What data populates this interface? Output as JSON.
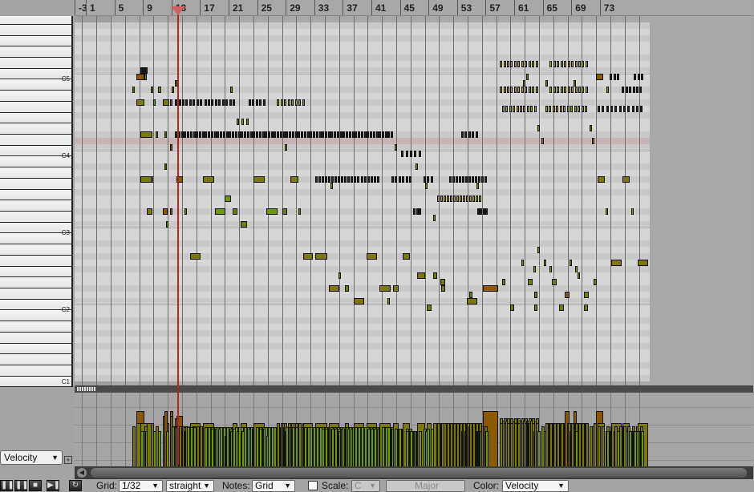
{
  "ruler": {
    "labels": [
      "-3",
      "1",
      "5",
      "9",
      "13",
      "17",
      "21",
      "25",
      "29",
      "33",
      "37",
      "41",
      "45",
      "49",
      "53",
      "57",
      "61",
      "65",
      "69",
      "73"
    ]
  },
  "keyboard": {
    "octave_labels": [
      {
        "label": "C5",
        "pitch": 72
      },
      {
        "label": "C4",
        "pitch": 60
      },
      {
        "label": "C3",
        "pitch": 48
      },
      {
        "label": "C2",
        "pitch": 36
      },
      {
        "label": "C1",
        "pitch": 24
      }
    ]
  },
  "highlight_pitch": 62,
  "playhead_bar": 10.4,
  "colors": {
    "vel_high": "#8a5a00",
    "vel_mid": "#7a7a00",
    "vel_low": "#6e9a00",
    "playhead": "#c02020",
    "highlight_row": "#c8b4b4"
  },
  "notes": [
    [
      72,
      4.6,
      1.1,
      110
    ],
    [
      72,
      5.7,
      0.3,
      80
    ],
    [
      72,
      59.2,
      0.15,
      90
    ],
    [
      72,
      69.0,
      1.0,
      110
    ],
    [
      71,
      10.0,
      0.2,
      95
    ],
    [
      71,
      58.8,
      0.15,
      90
    ],
    [
      71,
      61.9,
      0.15,
      80
    ],
    [
      71,
      65.8,
      0.15,
      110
    ],
    [
      70,
      4.0,
      0.2,
      80
    ],
    [
      70,
      6.6,
      0.2,
      80
    ],
    [
      70,
      7.6,
      0.5,
      70
    ],
    [
      70,
      9.5,
      0.2,
      80
    ],
    [
      70,
      17.7,
      0.15,
      70
    ],
    [
      70,
      70.4,
      0.15,
      70
    ],
    [
      68,
      4.6,
      1.1,
      85
    ],
    [
      68,
      7.0,
      0.2,
      70
    ],
    [
      68,
      8.3,
      0.9,
      85
    ],
    [
      68,
      9.3,
      0.3,
      110
    ],
    [
      65,
      18.6,
      0.15,
      70
    ],
    [
      65,
      19.3,
      0.15,
      70
    ],
    [
      65,
      20.0,
      0.15,
      70
    ],
    [
      64,
      60.8,
      0.15,
      70
    ],
    [
      64,
      68.1,
      0.15,
      80
    ],
    [
      63,
      5.2,
      1.6,
      85
    ],
    [
      63,
      7.3,
      0.3,
      80
    ],
    [
      63,
      8.5,
      0.4,
      85
    ],
    [
      62,
      61.3,
      0.15,
      80
    ],
    [
      62,
      68.4,
      0.15,
      80
    ],
    [
      61,
      9.3,
      0.3,
      110
    ],
    [
      61,
      25.4,
      0.15,
      70
    ],
    [
      61,
      40.8,
      0.15,
      70
    ],
    [
      58,
      8.5,
      0.2,
      110
    ],
    [
      58,
      43.7,
      0.15,
      70
    ],
    [
      56,
      5.2,
      1.6,
      85
    ],
    [
      56,
      6.6,
      0.2,
      85
    ],
    [
      56,
      10.2,
      0.9,
      100
    ],
    [
      56,
      13.9,
      1.6,
      85
    ],
    [
      56,
      21.0,
      1.6,
      85
    ],
    [
      56,
      26.2,
      1.1,
      85
    ],
    [
      56,
      69.2,
      1.0,
      85
    ],
    [
      56,
      72.7,
      1.0,
      85
    ],
    [
      55,
      31.8,
      0.15,
      70
    ],
    [
      55,
      45.0,
      0.15,
      70
    ],
    [
      55,
      52.2,
      0.15,
      70
    ],
    [
      53,
      17.0,
      0.8,
      60
    ],
    [
      51,
      6.1,
      0.7,
      85
    ],
    [
      51,
      8.3,
      0.7,
      100
    ],
    [
      51,
      9.3,
      0.3,
      100
    ],
    [
      51,
      11.3,
      0.15,
      70
    ],
    [
      51,
      15.6,
      1.5,
      60
    ],
    [
      51,
      18.1,
      0.7,
      85
    ],
    [
      51,
      22.8,
      1.6,
      60
    ],
    [
      51,
      25.0,
      0.7,
      85
    ],
    [
      51,
      27.3,
      0.15,
      70
    ],
    [
      51,
      70.3,
      0.15,
      70
    ],
    [
      51,
      73.9,
      0.15,
      70
    ],
    [
      50,
      46.2,
      0.2,
      70
    ],
    [
      49,
      19.2,
      0.9,
      85
    ],
    [
      49,
      8.8,
      0.15,
      70
    ],
    [
      45,
      60.8,
      0.15,
      70
    ],
    [
      44,
      12.1,
      1.5,
      85
    ],
    [
      44,
      28.0,
      1.3,
      85
    ],
    [
      44,
      29.7,
      1.6,
      85
    ],
    [
      44,
      36.8,
      1.5,
      85
    ],
    [
      44,
      41.9,
      1.0,
      85
    ],
    [
      43,
      58.5,
      0.15,
      70
    ],
    [
      43,
      61.7,
      0.15,
      70
    ],
    [
      43,
      65.3,
      0.15,
      70
    ],
    [
      43,
      71.1,
      1.5,
      85
    ],
    [
      43,
      74.8,
      1.5,
      85
    ],
    [
      42,
      60.2,
      0.15,
      70
    ],
    [
      42,
      62.5,
      0.15,
      70
    ],
    [
      42,
      66.1,
      0.15,
      70
    ],
    [
      41,
      32.9,
      0.2,
      70
    ],
    [
      41,
      43.9,
      1.2,
      85
    ],
    [
      41,
      46.2,
      0.5,
      85
    ],
    [
      41,
      66.4,
      0.2,
      80
    ],
    [
      40,
      55.8,
      0.5,
      85
    ],
    [
      40,
      59.4,
      0.7,
      85
    ],
    [
      40,
      62.8,
      0.7,
      85
    ],
    [
      40,
      68.6,
      0.5,
      85
    ],
    [
      40,
      47.2,
      0.7,
      85
    ],
    [
      39,
      31.6,
      1.4,
      85
    ],
    [
      39,
      33.8,
      0.6,
      85
    ],
    [
      39,
      38.6,
      1.6,
      85
    ],
    [
      39,
      40.6,
      0.7,
      85
    ],
    [
      39,
      47.3,
      0.5,
      85
    ],
    [
      39,
      53.1,
      2.2,
      110
    ],
    [
      38,
      51.2,
      0.5,
      85
    ],
    [
      38,
      60.3,
      0.5,
      85
    ],
    [
      38,
      64.6,
      0.7,
      110
    ],
    [
      38,
      67.3,
      0.7,
      85
    ],
    [
      37,
      35.0,
      1.5,
      85
    ],
    [
      37,
      39.8,
      0.3,
      70
    ],
    [
      37,
      50.9,
      1.5,
      85
    ],
    [
      36,
      45.3,
      0.7,
      85
    ],
    [
      36,
      57.0,
      0.5,
      85
    ],
    [
      36,
      60.3,
      0.5,
      85
    ],
    [
      36,
      63.8,
      0.7,
      85
    ],
    [
      36,
      67.3,
      0.5,
      85
    ]
  ],
  "runs": [
    [
      74,
      55.5,
      60.6,
      0.5,
      95
    ],
    [
      74,
      62.5,
      67.5,
      0.5,
      85
    ],
    [
      73,
      5.2,
      5.8,
      0.3,
      70
    ],
    [
      72,
      70.9,
      72.0,
      0.5,
      70
    ],
    [
      72,
      74.3,
      75.4,
      0.5,
      70
    ],
    [
      70,
      55.5,
      60.6,
      0.5,
      85
    ],
    [
      70,
      62.5,
      67.5,
      0.5,
      85
    ],
    [
      70,
      72.6,
      75.4,
      0.5,
      70
    ],
    [
      68,
      10.0,
      13.6,
      0.5,
      80
    ],
    [
      68,
      14.1,
      18.1,
      0.5,
      75
    ],
    [
      68,
      20.3,
      22.6,
      0.5,
      75
    ],
    [
      68,
      24.3,
      28.2,
      0.5,
      85
    ],
    [
      67,
      55.8,
      60.6,
      0.5,
      90
    ],
    [
      67,
      61.9,
      67.5,
      0.5,
      85
    ],
    [
      67,
      69.2,
      75.4,
      0.6,
      80
    ],
    [
      63,
      10.0,
      40.6,
      0.42,
      78
    ],
    [
      63,
      50.1,
      52.3,
      0.5,
      70
    ],
    [
      60,
      41.7,
      44.5,
      0.6,
      70
    ],
    [
      56,
      29.7,
      38.3,
      0.45,
      75
    ],
    [
      56,
      40.3,
      42.8,
      0.5,
      75
    ],
    [
      56,
      44.8,
      46.2,
      0.5,
      75
    ],
    [
      56,
      48.4,
      53.5,
      0.45,
      80
    ],
    [
      53,
      46.7,
      52.9,
      0.45,
      85
    ],
    [
      51,
      43.4,
      44.5,
      0.4,
      70
    ],
    [
      51,
      52.3,
      53.8,
      0.4,
      70
    ]
  ],
  "velocity_lane": {
    "lane_label": "Velocity",
    "add_lane": "+"
  },
  "transport": {
    "buttons": [
      "pause",
      "stop",
      "skip-end",
      "repeat"
    ]
  },
  "toolbar": {
    "grid_label": "Grid:",
    "grid_value": "1/32",
    "swing_value": "straight",
    "notes_label": "Notes:",
    "notes_value": "Grid",
    "scale_checked": false,
    "scale_label": "Scale:",
    "scale_root": "C",
    "scale_type": "Major",
    "color_label": "Color:",
    "color_value": "Velocity"
  }
}
